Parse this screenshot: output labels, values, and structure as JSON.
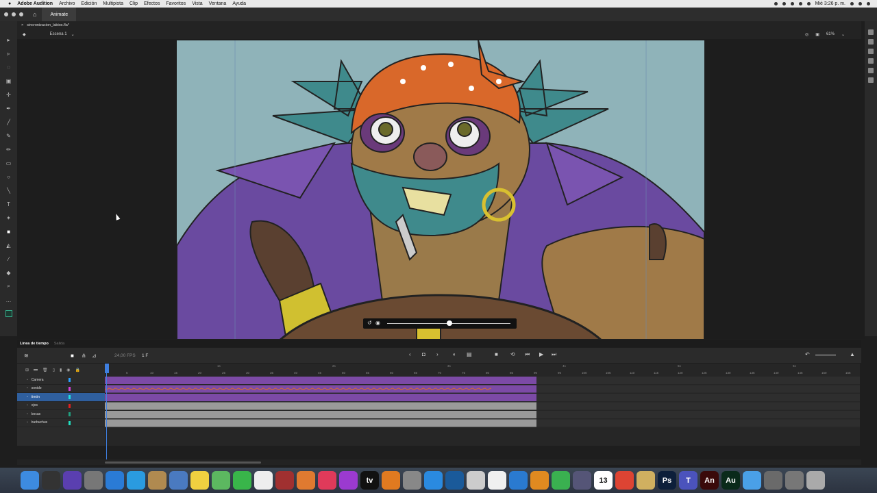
{
  "menubar": {
    "app_name": "Adobe Audition",
    "menus": [
      "Archivo",
      "Edición",
      "Multipista",
      "Clip",
      "Efectos",
      "Favoritos",
      "Vista",
      "Ventana",
      "Ayuda"
    ],
    "clock": "Mié 3:26 p. m."
  },
  "titlebar": {
    "workspace": "Animate"
  },
  "document": {
    "tab": "sincronizacion_labios.fla*"
  },
  "scene": {
    "name": "Escena 1",
    "zoom": "61%"
  },
  "timeline": {
    "tab_active": "Línea de tiempo",
    "tab_other": "Salida",
    "fps": "24,00 FPS",
    "frame": "1 F",
    "ruler_ticks": [
      "1s",
      "2s",
      "3s",
      "4s",
      "5s",
      "6s"
    ],
    "ruler_numbers": [
      "5",
      "10",
      "15",
      "20",
      "25",
      "30",
      "35",
      "40",
      "45",
      "50",
      "55",
      "60",
      "65",
      "70",
      "75",
      "80",
      "85",
      "90",
      "95",
      "100",
      "105",
      "110",
      "115",
      "120",
      "125",
      "130",
      "135",
      "140",
      "145",
      "150",
      "155"
    ],
    "layers": [
      {
        "name": "Camera",
        "color": "#2aa0ff",
        "selected": false
      },
      {
        "name": "sonido",
        "color": "#d43fd8",
        "selected": false
      },
      {
        "name": "timón",
        "color": "#20e0e0",
        "selected": true
      },
      {
        "name": "ojos",
        "color": "#e02020",
        "selected": false
      },
      {
        "name": "bocas",
        "color": "#20a080",
        "selected": false
      },
      {
        "name": "burbuchus",
        "color": "#20e0c0",
        "selected": false
      }
    ]
  },
  "colors": {
    "accent": "#3f7fe0",
    "purple_track": "#7c4aa6",
    "gray_track": "#9a9a9a"
  },
  "dock": {
    "apps": [
      {
        "name": "finder",
        "color": "#3d8be0",
        "glyph": ""
      },
      {
        "name": "mission-control",
        "color": "#333",
        "glyph": ""
      },
      {
        "name": "siri",
        "color": "#5a3fb0",
        "glyph": ""
      },
      {
        "name": "launchpad",
        "color": "#777",
        "glyph": ""
      },
      {
        "name": "safari",
        "color": "#2a7bd6",
        "glyph": ""
      },
      {
        "name": "messages",
        "color": "#2a9be0",
        "glyph": ""
      },
      {
        "name": "contacts",
        "color": "#b08a50",
        "glyph": ""
      },
      {
        "name": "preview",
        "color": "#4a7ac0",
        "glyph": ""
      },
      {
        "name": "notes",
        "color": "#f0d040",
        "glyph": ""
      },
      {
        "name": "maps",
        "color": "#5cb860",
        "glyph": ""
      },
      {
        "name": "facetime",
        "color": "#39b54a",
        "glyph": ""
      },
      {
        "name": "reminders",
        "color": "#eee",
        "glyph": ""
      },
      {
        "name": "photo-booth",
        "color": "#a03030",
        "glyph": ""
      },
      {
        "name": "photos",
        "color": "#e07a30",
        "glyph": ""
      },
      {
        "name": "music",
        "color": "#e03a5a",
        "glyph": ""
      },
      {
        "name": "podcasts",
        "color": "#9b3ad0",
        "glyph": ""
      },
      {
        "name": "apple-tv",
        "color": "#111",
        "glyph": "tv"
      },
      {
        "name": "books",
        "color": "#e07a20",
        "glyph": ""
      },
      {
        "name": "system-preferences",
        "color": "#888",
        "glyph": ""
      },
      {
        "name": "app-store",
        "color": "#2a8ae0",
        "glyph": ""
      },
      {
        "name": "quicktime",
        "color": "#1a5a9a",
        "glyph": ""
      },
      {
        "name": "script-editor",
        "color": "#ccc",
        "glyph": ""
      },
      {
        "name": "textedit",
        "color": "#f0f0f0",
        "glyph": ""
      },
      {
        "name": "keynote",
        "color": "#2a7ad0",
        "glyph": ""
      },
      {
        "name": "pages",
        "color": "#e08a20",
        "glyph": ""
      },
      {
        "name": "numbers",
        "color": "#3ab050",
        "glyph": ""
      },
      {
        "name": "image-capture",
        "color": "#557",
        "glyph": ""
      },
      {
        "name": "calendar",
        "color": "#fff",
        "glyph": "13"
      },
      {
        "name": "chrome",
        "color": "#dd4433",
        "glyph": ""
      },
      {
        "name": "archive",
        "color": "#d0b060",
        "glyph": ""
      },
      {
        "name": "photoshop",
        "color": "#0d1f3a",
        "glyph": "Ps"
      },
      {
        "name": "teams",
        "color": "#4b53bc",
        "glyph": "T"
      },
      {
        "name": "animate",
        "color": "#3a0a0a",
        "glyph": "An"
      },
      {
        "name": "audition",
        "color": "#0a2a1a",
        "glyph": "Au"
      },
      {
        "name": "folder",
        "color": "#4aa0e8",
        "glyph": ""
      },
      {
        "name": "downloads",
        "color": "#6a6a6a",
        "glyph": ""
      },
      {
        "name": "screens",
        "color": "#777",
        "glyph": ""
      },
      {
        "name": "trash",
        "color": "#aaa",
        "glyph": ""
      }
    ]
  }
}
